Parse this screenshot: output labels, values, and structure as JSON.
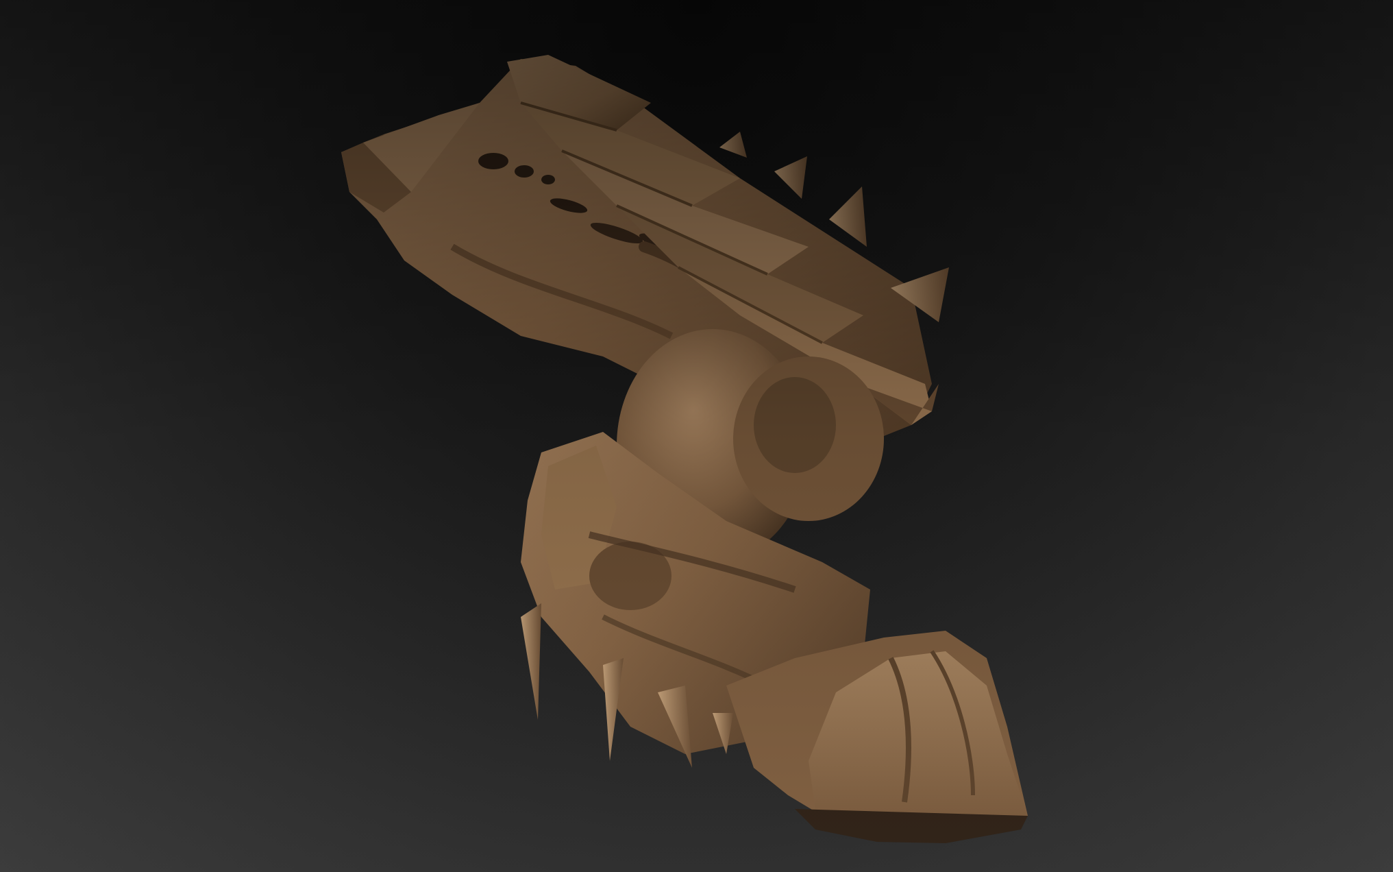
{
  "canvas": {
    "background_top": "#101010",
    "background_bottom": "#3a3a3a"
  },
  "model": {
    "base_color": "#8c6a49",
    "light_color": "#b08a64",
    "shadow_color": "#4a3522",
    "dark_color": "#2e2015"
  }
}
